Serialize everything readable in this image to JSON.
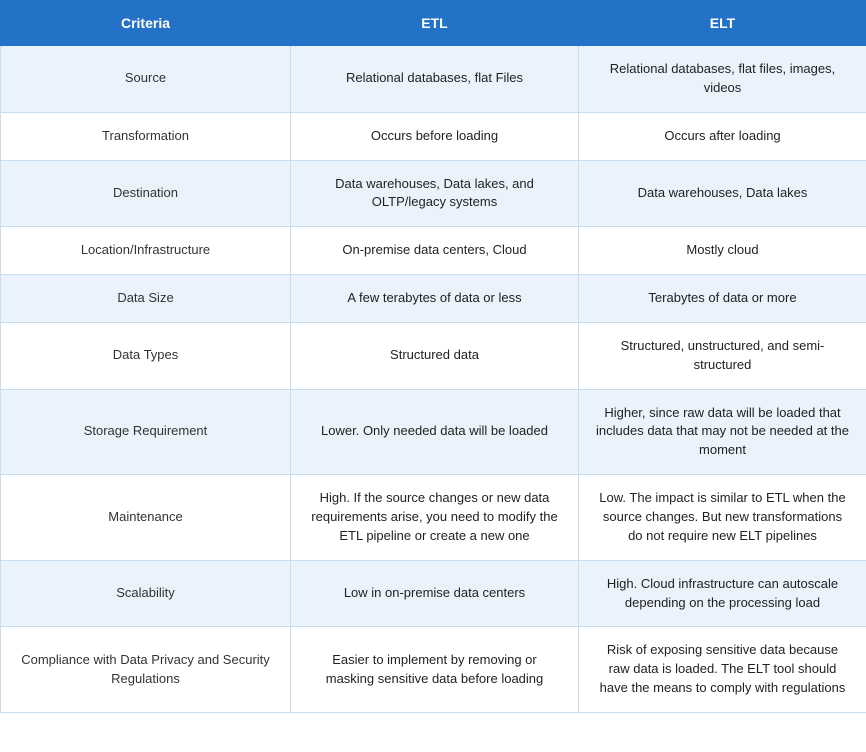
{
  "table": {
    "headers": {
      "criteria": "Criteria",
      "etl": "ETL",
      "elt": "ELT"
    },
    "rows": [
      {
        "criteria": "Source",
        "etl": "Relational databases, flat Files",
        "elt": "Relational databases, flat files, images, videos"
      },
      {
        "criteria": "Transformation",
        "etl": "Occurs before loading",
        "elt": "Occurs after loading"
      },
      {
        "criteria": "Destination",
        "etl": "Data warehouses, Data lakes, and OLTP/legacy systems",
        "elt": "Data warehouses, Data lakes"
      },
      {
        "criteria": "Location/Infrastructure",
        "etl": "On-premise data centers, Cloud",
        "elt": "Mostly cloud"
      },
      {
        "criteria": "Data Size",
        "etl": "A few terabytes of data or less",
        "elt": "Terabytes of data or more"
      },
      {
        "criteria": "Data Types",
        "etl": "Structured data",
        "elt": "Structured, unstructured, and semi-structured"
      },
      {
        "criteria": "Storage Requirement",
        "etl": "Lower. Only needed data will be loaded",
        "elt": "Higher, since raw data will be loaded that includes data that may not be needed at the moment"
      },
      {
        "criteria": "Maintenance",
        "etl": "High. If the source changes or new data requirements arise, you need to modify the ETL pipeline or create a new one",
        "elt": "Low. The impact is similar to ETL when the source changes. But new transformations do not require new ELT pipelines"
      },
      {
        "criteria": "Scalability",
        "etl": "Low in on-premise data centers",
        "elt": "High. Cloud infrastructure can autoscale depending on the processing load"
      },
      {
        "criteria": "Compliance with Data Privacy and Security Regulations",
        "etl": "Easier to implement by removing or masking sensitive data before loading",
        "elt": "Risk of exposing sensitive data because raw data is loaded. The ELT tool should have the means to comply with regulations"
      }
    ]
  }
}
